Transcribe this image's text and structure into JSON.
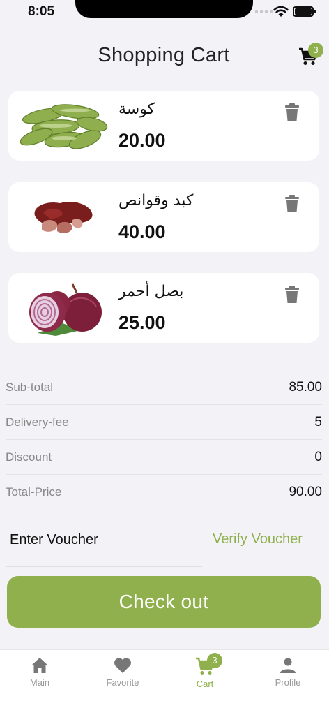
{
  "status_bar": {
    "time": "8:05"
  },
  "header": {
    "title": "Shopping Cart",
    "cart_count": "3"
  },
  "cart_items": [
    {
      "name": "كوسة",
      "price": "20.00",
      "image": "zucchini"
    },
    {
      "name": "كبد وقوانص",
      "price": "40.00",
      "image": "liver-and-gizzards"
    },
    {
      "name": "بصل أحمر",
      "price": "25.00",
      "image": "red-onion"
    }
  ],
  "summary": {
    "subtotal_label": "Sub-total",
    "subtotal_value": "85.00",
    "delivery_label": "Delivery-fee",
    "delivery_value": "5",
    "discount_label": "Discount",
    "discount_value": "0",
    "total_label": "Total-Price",
    "total_value": "90.00"
  },
  "voucher": {
    "input_text": "Enter Voucher",
    "verify_label": "Verify Voucher"
  },
  "checkout_label": "Check out",
  "bottom_nav": {
    "items": [
      {
        "label": "Main",
        "icon": "home-icon"
      },
      {
        "label": "Favorite",
        "icon": "heart-icon"
      },
      {
        "label": "Cart",
        "icon": "cart-icon",
        "badge": "3",
        "active": true
      },
      {
        "label": "Profile",
        "icon": "person-icon"
      }
    ]
  },
  "colors": {
    "accent": "#8fb04c",
    "background": "#f3f3f7",
    "card": "#ffffff",
    "muted": "#888888"
  }
}
